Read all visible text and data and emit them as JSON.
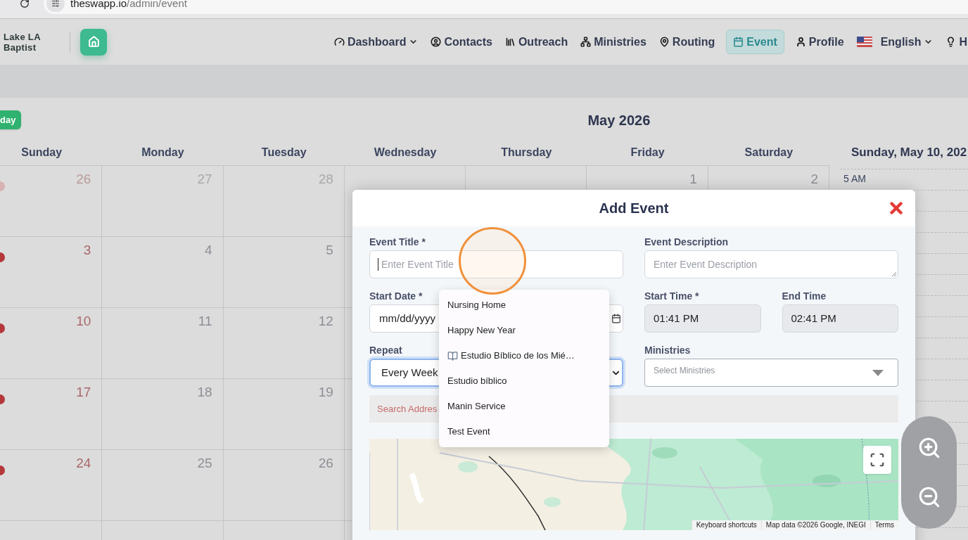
{
  "browser": {
    "url_host": "theswapp.io",
    "url_path": "/admin/event"
  },
  "nav": {
    "brand_lines": [
      "Lake LA",
      "Baptist"
    ],
    "items": [
      {
        "label": "Dashboard",
        "kind": "gauge",
        "caret": true,
        "selected": false
      },
      {
        "label": "Contacts",
        "kind": "contacts",
        "caret": false,
        "selected": false
      },
      {
        "label": "Outreach",
        "kind": "outreach",
        "caret": false,
        "selected": false
      },
      {
        "label": "Ministries",
        "kind": "ministries",
        "caret": false,
        "selected": false
      },
      {
        "label": "Routing",
        "kind": "routing",
        "caret": false,
        "selected": false
      },
      {
        "label": "Event",
        "kind": "event",
        "caret": false,
        "selected": true
      },
      {
        "label": "Profile",
        "kind": "profile",
        "caret": false,
        "selected": false
      },
      {
        "label": "English",
        "kind": "language",
        "caret": true,
        "selected": false
      },
      {
        "label": "H",
        "kind": "help",
        "caret": false,
        "selected": false
      }
    ]
  },
  "calendar": {
    "today_button": "day",
    "month_title": "May 2026",
    "weekdays": [
      "Sunday",
      "Monday",
      "Tuesday",
      "Wednesday",
      "Thursday",
      "Friday",
      "Saturday"
    ],
    "weeks": [
      [
        {
          "kind": "day",
          "day": "26",
          "other_month": true,
          "event": true
        },
        {
          "kind": "day",
          "day": "27",
          "other_month": true,
          "event": false
        },
        {
          "kind": "day",
          "day": "28",
          "other_month": true,
          "event": false
        },
        {
          "kind": "covered"
        },
        {
          "kind": "covered"
        },
        {
          "kind": "day",
          "day": "1",
          "other_month": false,
          "event": false
        },
        {
          "kind": "day",
          "day": "2",
          "other_month": false,
          "event": false
        }
      ],
      [
        {
          "kind": "day",
          "day": "3",
          "other_month": false,
          "event": true
        },
        {
          "kind": "day",
          "day": "4",
          "other_month": false,
          "event": false
        },
        {
          "kind": "day",
          "day": "5",
          "other_month": false,
          "event": false
        }
      ],
      [
        {
          "kind": "day",
          "day": "10",
          "other_month": false,
          "event": true
        },
        {
          "kind": "day",
          "day": "11",
          "other_month": false,
          "event": false
        },
        {
          "kind": "day",
          "day": "12",
          "other_month": false,
          "event": false
        }
      ],
      [
        {
          "kind": "day",
          "day": "17",
          "other_month": false,
          "event": true
        },
        {
          "kind": "day",
          "day": "18",
          "other_month": false,
          "event": false
        },
        {
          "kind": "day",
          "day": "19",
          "other_month": false,
          "event": false
        }
      ],
      [
        {
          "kind": "day",
          "day": "24",
          "other_month": false,
          "event": true
        },
        {
          "kind": "day",
          "day": "25",
          "other_month": false,
          "event": false
        },
        {
          "kind": "day",
          "day": "26",
          "other_month": false,
          "event": false
        }
      ]
    ]
  },
  "day_panel": {
    "title": "Sunday, May 10, 202",
    "times": [
      "5 AM"
    ]
  },
  "modal": {
    "title": "Add Event",
    "event_title": {
      "label": "Event Title *",
      "placeholder": "Enter Event Title"
    },
    "start_date": {
      "label": "Start Date *",
      "value": "mm/dd/yyyy"
    },
    "repeat": {
      "label": "Repeat",
      "value": "Every Week"
    },
    "description": {
      "label": "Event Description",
      "placeholder": "Enter Event Description"
    },
    "start_time": {
      "label": "Start Time *",
      "value": "01:41 PM"
    },
    "end_time": {
      "label": "End Time",
      "value": "02:41 PM"
    },
    "ministries": {
      "label": "Ministries",
      "placeholder": "Select Ministries"
    },
    "address": {
      "placeholder": "Search Addres"
    },
    "map": {
      "attribution": [
        "Keyboard shortcuts",
        "Map data ©2026 Google, INEGI",
        "Terms"
      ]
    }
  },
  "dropdown": {
    "items": [
      {
        "label": "Nursing Home",
        "kind": "text"
      },
      {
        "label": "Happy New Year",
        "kind": "text"
      },
      {
        "label": "Estudio Bíblico de los Mié…",
        "kind": "book"
      },
      {
        "label": "Estudio bíblico",
        "kind": "text"
      },
      {
        "label": "Manin Service",
        "kind": "text"
      },
      {
        "label": "Test Event",
        "kind": "text"
      }
    ]
  }
}
